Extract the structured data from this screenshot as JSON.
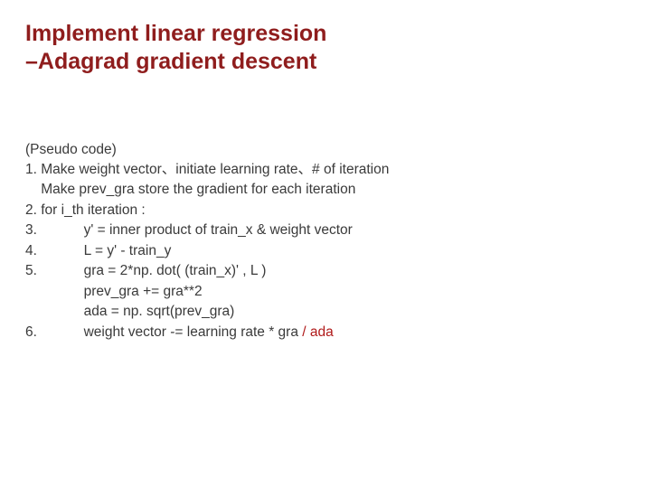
{
  "title_line1": "Implement linear regression",
  "title_line2": "–Adagrad gradient descent",
  "pc_label": "(Pseudo code)",
  "lines": {
    "l1a": "1. Make weight vector、initiate learning rate、# of iteration",
    "l1b": "    Make prev_gra store the gradient for each iteration",
    "l2": "2. for i_th iteration :",
    "l3": "3.            y' = inner product of train_x & weight vector",
    "l4": "4.            L = y' - train_y",
    "l5": "5.            gra = 2*np. dot( (train_x)' , L )",
    "l5b": "               prev_gra += gra**2",
    "l5c": "               ada = np. sqrt(prev_gra)",
    "l6a": "6.            weight vector -= learning rate * gra ",
    "l6b": "/ ada"
  }
}
